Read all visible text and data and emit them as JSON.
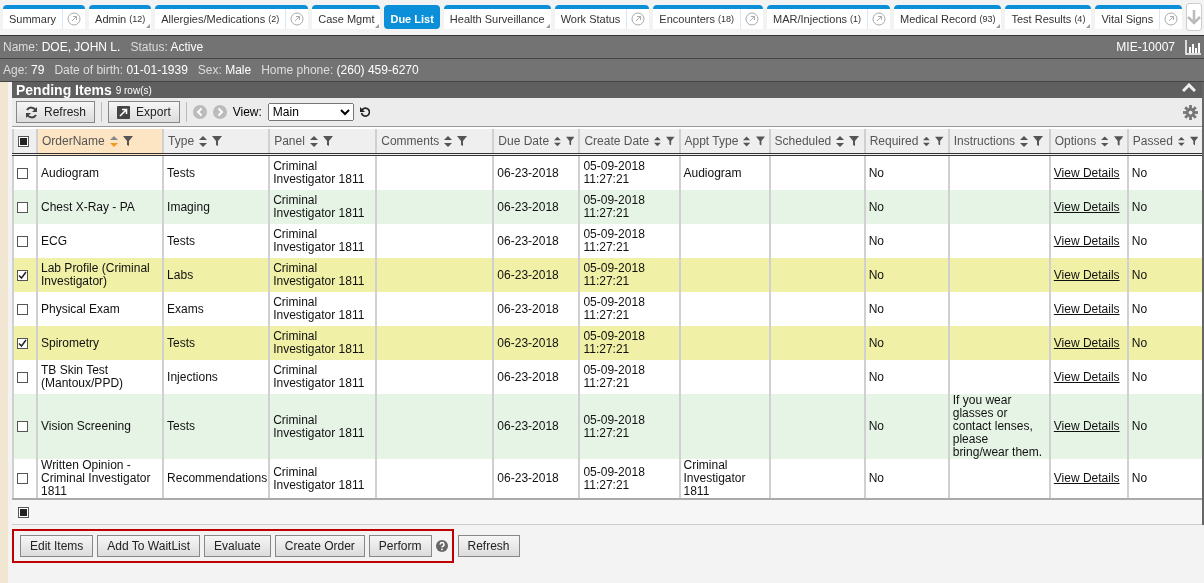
{
  "tabs": [
    {
      "label": "Summary",
      "selected": false,
      "popout": true,
      "corner": false
    },
    {
      "label": "Admin",
      "count": "(12)",
      "selected": false,
      "popout": false,
      "corner": true
    },
    {
      "label": "Allergies/Medications",
      "count": "(2)",
      "selected": false,
      "popout": true,
      "corner": false
    },
    {
      "label": "Case Mgmt",
      "selected": false,
      "popout": false,
      "corner": true
    },
    {
      "label": "Due List",
      "selected": true,
      "popout": false,
      "corner": false
    },
    {
      "label": "Health Surveillance",
      "selected": false,
      "popout": false,
      "corner": true
    },
    {
      "label": "Work Status",
      "selected": false,
      "popout": true,
      "corner": false
    },
    {
      "label": "Encounters",
      "count": "(18)",
      "selected": false,
      "popout": true,
      "corner": false
    },
    {
      "label": "MAR/Injections",
      "count": "(1)",
      "selected": false,
      "popout": true,
      "corner": false
    },
    {
      "label": "Medical Record",
      "count": "(93)",
      "selected": false,
      "popout": false,
      "corner": true
    },
    {
      "label": "Test Results",
      "count": "(4)",
      "selected": false,
      "popout": false,
      "corner": true
    },
    {
      "label": "Vital Signs",
      "selected": false,
      "popout": true,
      "corner": false
    }
  ],
  "patient": {
    "line_1": [
      {
        "label": "Name:",
        "value": "DOE, JOHN L."
      },
      {
        "label": "Status:",
        "value": "Active"
      }
    ],
    "record_id": "MIE-10007",
    "line_2": [
      {
        "label": "Age:",
        "value": "79"
      },
      {
        "label": "Date of birth:",
        "value": "01-01-1939"
      },
      {
        "label": "Sex:",
        "value": "Male"
      },
      {
        "label": "Home phone:",
        "value": "(260) 459-6270"
      }
    ]
  },
  "panel": {
    "title": "Pending Items",
    "row_count": "9 row(s)",
    "toolbar": {
      "refresh": "Refresh",
      "export": "Export",
      "view_label": "View:",
      "view_value": "Main"
    },
    "table": {
      "header_checkbox": {
        "indeterminate": true
      },
      "footer_checkbox": {
        "indeterminate": true
      },
      "columns": [
        {
          "label": "OrderName",
          "sorted": true
        },
        {
          "label": "Type",
          "sorted": false
        },
        {
          "label": "Panel",
          "sorted": false
        },
        {
          "label": "Comments",
          "sorted": false
        },
        {
          "label": "Due Date",
          "sorted": false
        },
        {
          "label": "Create Date",
          "sorted": false
        },
        {
          "label": "Appt Type",
          "sorted": false
        },
        {
          "label": "Scheduled",
          "sorted": false
        },
        {
          "label": "Required",
          "sorted": false
        },
        {
          "label": "Instructions",
          "sorted": false
        },
        {
          "label": "Options",
          "sorted": false
        },
        {
          "label": "Passed",
          "sorted": false
        }
      ],
      "rows": [
        {
          "checked": false,
          "cells": [
            "Audiogram",
            "Tests",
            "Criminal Investigator 1811",
            "",
            "06-23-2018",
            "05-09-2018 11:27:21",
            "Audiogram",
            "",
            "No",
            "",
            "View Details",
            "No"
          ]
        },
        {
          "checked": false,
          "cells": [
            "Chest X-Ray - PA",
            "Imaging",
            "Criminal Investigator 1811",
            "",
            "06-23-2018",
            "05-09-2018 11:27:21",
            "",
            "",
            "No",
            "",
            "View Details",
            "No"
          ]
        },
        {
          "checked": false,
          "cells": [
            "ECG",
            "Tests",
            "Criminal Investigator 1811",
            "",
            "06-23-2018",
            "05-09-2018 11:27:21",
            "",
            "",
            "No",
            "",
            "View Details",
            "No"
          ]
        },
        {
          "checked": true,
          "cells": [
            "Lab Profile (Criminal Investigator)",
            "Labs",
            "Criminal Investigator 1811",
            "",
            "06-23-2018",
            "05-09-2018 11:27:21",
            "",
            "",
            "No",
            "",
            "View Details",
            "No"
          ]
        },
        {
          "checked": false,
          "cells": [
            "Physical Exam",
            "Exams",
            "Criminal Investigator 1811",
            "",
            "06-23-2018",
            "05-09-2018 11:27:21",
            "",
            "",
            "No",
            "",
            "View Details",
            "No"
          ]
        },
        {
          "checked": true,
          "cells": [
            "Spirometry",
            "Tests",
            "Criminal Investigator 1811",
            "",
            "06-23-2018",
            "05-09-2018 11:27:21",
            "",
            "",
            "No",
            "",
            "View Details",
            "No"
          ]
        },
        {
          "checked": false,
          "cells": [
            "TB Skin Test (Mantoux/PPD)",
            "Injections",
            "Criminal Investigator 1811",
            "",
            "06-23-2018",
            "05-09-2018 11:27:21",
            "",
            "",
            "No",
            "",
            "View Details",
            "No"
          ]
        },
        {
          "checked": false,
          "cells": [
            "Vision Screening",
            "Tests",
            "Criminal Investigator 1811",
            "",
            "06-23-2018",
            "05-09-2018 11:27:21",
            "",
            "",
            "No",
            "If you wear glasses or contact lenses, please bring/wear them.",
            "View Details",
            "No"
          ]
        },
        {
          "checked": false,
          "cells": [
            "Written Opinion - Criminal Investigator 1811",
            "Recommendations",
            "Criminal Investigator 1811",
            "",
            "06-23-2018",
            "05-09-2018 11:27:21",
            "Criminal Investigator 1811",
            "",
            "No",
            "",
            "View Details",
            "No"
          ]
        }
      ]
    }
  },
  "actions": {
    "highlighted": [
      "Edit Items",
      "Add To WaitList",
      "Evaluate",
      "Create Order",
      "Perform"
    ],
    "other": [
      "Refresh"
    ]
  }
}
